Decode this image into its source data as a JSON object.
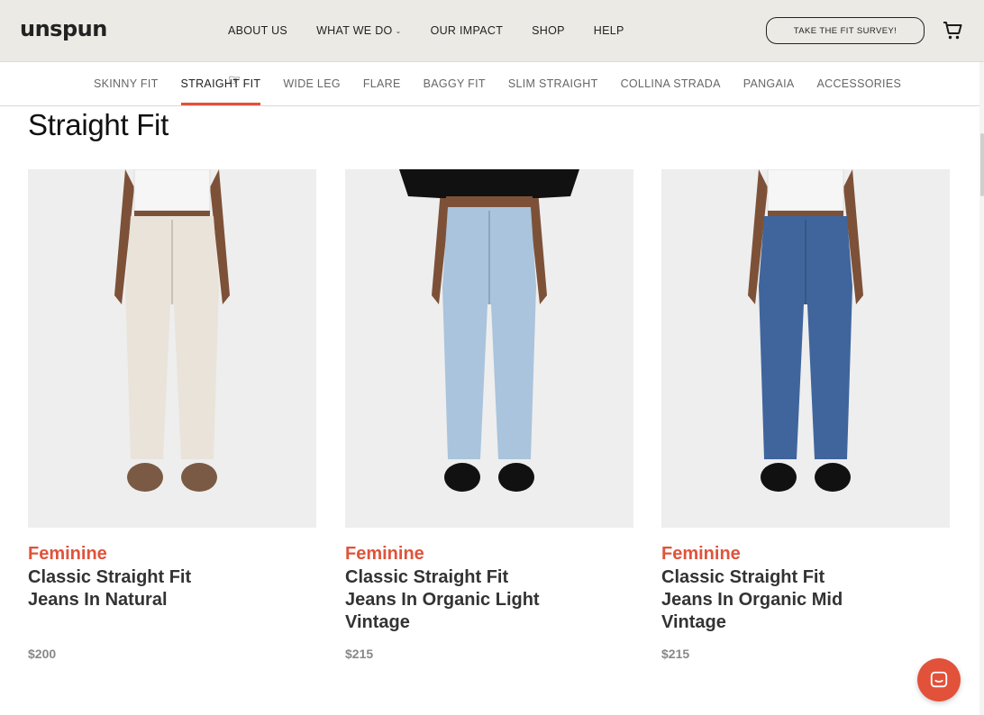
{
  "brand": {
    "logo_text": "unspun"
  },
  "main_nav": {
    "about": "ABOUT US",
    "what_we_do": "WHAT WE DO",
    "impact": "OUR IMPACT",
    "shop": "SHOP",
    "help": "HELP"
  },
  "header": {
    "survey_button": "TAKE THE FIT SURVEY!",
    "cart_icon": "shopping-cart-icon"
  },
  "subnav": {
    "items": [
      {
        "label": "SKINNY FIT"
      },
      {
        "label": "STRAIGHT FIT",
        "active": true
      },
      {
        "label": "WIDE LEG"
      },
      {
        "label": "FLARE"
      },
      {
        "label": "BAGGY FIT"
      },
      {
        "label": "SLIM STRAIGHT"
      },
      {
        "label": "COLLINA STRADA"
      },
      {
        "label": "PANGAIA"
      },
      {
        "label": "ACCESSORIES"
      }
    ]
  },
  "page": {
    "title": "Straight Fit"
  },
  "products": [
    {
      "category": "Feminine",
      "name": "Classic Straight Fit Jeans In Natural",
      "price": "$200",
      "colors": {
        "top": "#f6f6f6",
        "jeans": "#e9e3da",
        "shoes": "#7a5a44"
      }
    },
    {
      "category": "Feminine",
      "name": "Classic Straight Fit Jeans In Organic Light Vintage",
      "price": "$215",
      "colors": {
        "top": "#111111",
        "jeans": "#a9c4dc",
        "shoes": "#111111"
      }
    },
    {
      "category": "Feminine",
      "name": "Classic Straight Fit Jeans In Organic Mid Vintage",
      "price": "$215",
      "colors": {
        "top": "#f6f6f6",
        "jeans": "#3f659c",
        "shoes": "#111111"
      }
    }
  ],
  "colors": {
    "accent": "#e2513a",
    "header_bg": "#ebeae5",
    "skin": "#7d5138"
  },
  "chat": {
    "icon": "chat-bubble-icon"
  }
}
